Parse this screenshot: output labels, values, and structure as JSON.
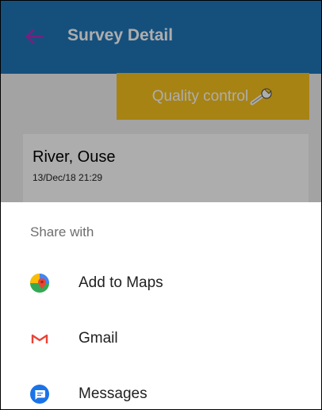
{
  "appbar": {
    "title": "Survey Detail",
    "back_icon": "arrow-back-icon",
    "color": "#1f77b8",
    "back_color": "#b030c0"
  },
  "content": {
    "quality_button": {
      "label": "Quality control",
      "icon": "wrench-icon",
      "color": "#f6c21d"
    },
    "survey": {
      "name": "River, Ouse",
      "date": "13/Dec/18 21:29"
    }
  },
  "share_sheet": {
    "title": "Share with",
    "items": [
      {
        "label": "Add to Maps",
        "icon": "google-maps-icon"
      },
      {
        "label": "Gmail",
        "icon": "gmail-icon"
      },
      {
        "label": "Messages",
        "icon": "messages-icon"
      }
    ]
  }
}
